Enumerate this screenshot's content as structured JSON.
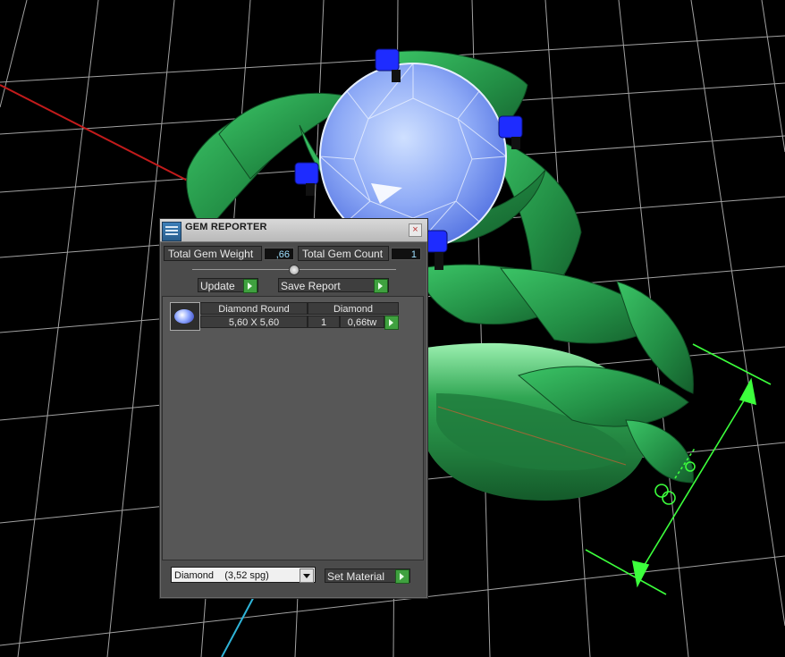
{
  "panel": {
    "title": "GEM REPORTER",
    "close_glyph": "×",
    "total_weight_label": "Total Gem Weight",
    "total_weight_value": ",66",
    "total_count_label": "Total Gem Count",
    "total_count_value": "1",
    "update_label": "Update",
    "save_report_label": "Save Report"
  },
  "gems": [
    {
      "name": "Diamond Round",
      "material": "Diamond",
      "size": "5,60 X 5,60",
      "count": "1",
      "weight": "0,66tw"
    }
  ],
  "footer": {
    "material_select": "Diamond    (3,52 spg)",
    "set_material_label": "Set Material"
  },
  "colors": {
    "ring_green": "#2f9a4c",
    "gem_blue": "#8fb0ff",
    "prong_blue": "#1f2cff",
    "dimension_green": "#39ff3a",
    "accent_button_green": "#3fa13f"
  },
  "icons": [
    "gem-reporter-app-icon",
    "close-icon",
    "slider-knob",
    "play-arrow-icon",
    "dropdown-arrow-icon"
  ]
}
